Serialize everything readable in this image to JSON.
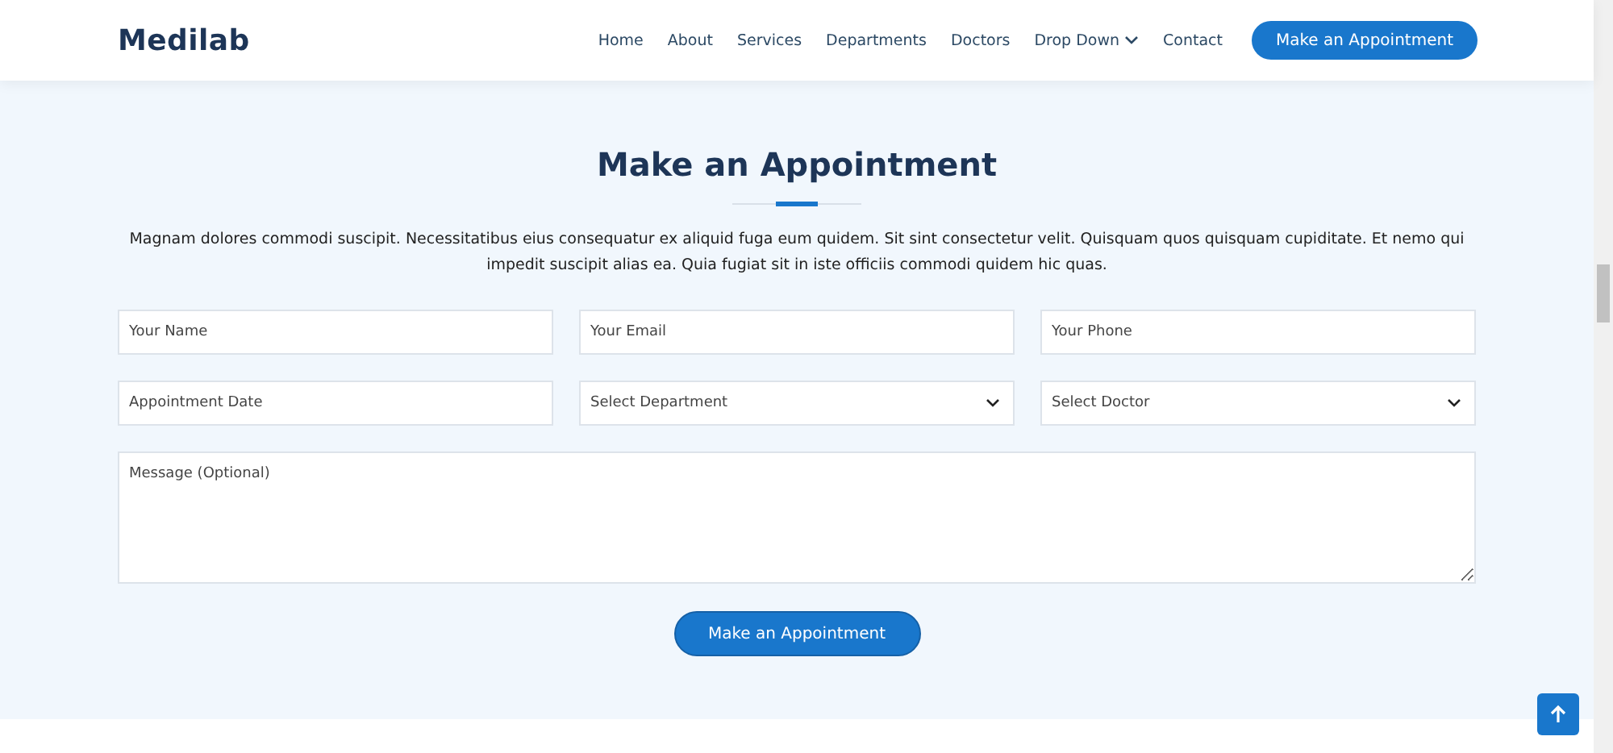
{
  "header": {
    "logo": "Medilab",
    "nav": [
      {
        "label": "Home",
        "dropdown": false
      },
      {
        "label": "About",
        "dropdown": false
      },
      {
        "label": "Services",
        "dropdown": false
      },
      {
        "label": "Departments",
        "dropdown": false
      },
      {
        "label": "Doctors",
        "dropdown": false
      },
      {
        "label": "Drop Down",
        "dropdown": true
      },
      {
        "label": "Contact",
        "dropdown": false
      }
    ],
    "cta": "Make an Appointment"
  },
  "section": {
    "title": "Make an Appointment",
    "description": "Magnam dolores commodi suscipit. Necessitatibus eius consequatur ex aliquid fuga eum quidem. Sit sint consectetur velit. Quisquam quos quisquam cupiditate. Et nemo qui impedit suscipit alias ea. Quia fugiat sit in iste officiis commodi quidem hic quas.",
    "fields": [
      {
        "kind": "input",
        "placeholder": "Your Name"
      },
      {
        "kind": "input",
        "placeholder": "Your Email"
      },
      {
        "kind": "input",
        "placeholder": "Your Phone"
      },
      {
        "kind": "input",
        "placeholder": "Appointment Date"
      },
      {
        "kind": "select",
        "value": "Select Department"
      },
      {
        "kind": "select",
        "value": "Select Doctor"
      }
    ],
    "message": {
      "placeholder": "Message (Optional)"
    },
    "submit": "Make an Appointment"
  }
}
